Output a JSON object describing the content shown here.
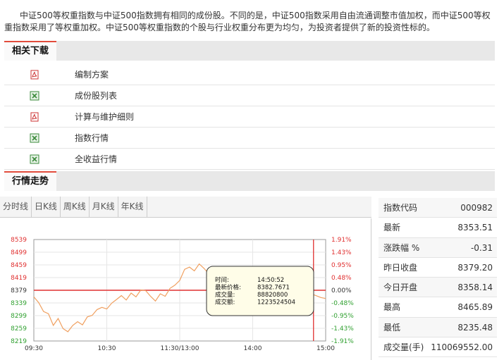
{
  "intro": "中证500等权重指数与中证500指数拥有相同的成份股。不同的是，中证500指数采用自由流通调整市值加权，而中证500等权重指数采用了等权重加权。中证500等权重指数的个股与行业权重分布更为均匀，为投资者提供了新的投资性标的。",
  "downloads": {
    "title": "相关下载",
    "items": [
      {
        "label": "编制方案",
        "icon": "pdf-icon"
      },
      {
        "label": "成份股列表",
        "icon": "excel-icon"
      },
      {
        "label": "计算与维护细则",
        "icon": "pdf-icon"
      },
      {
        "label": "指数行情",
        "icon": "excel-icon"
      },
      {
        "label": "全收益行情",
        "icon": "excel-icon"
      }
    ]
  },
  "market": {
    "title": "行情走势",
    "tabs": [
      "分时线",
      "日K线",
      "周K线",
      "月K线",
      "年K线"
    ]
  },
  "quote": [
    {
      "label": "指数代码",
      "value": "000982"
    },
    {
      "label": "最新",
      "value": "8353.51"
    },
    {
      "label": "涨跌幅 %",
      "value": "-0.31"
    },
    {
      "label": "昨日收盘",
      "value": "8379.20"
    },
    {
      "label": "今日开盘",
      "value": "8358.14"
    },
    {
      "label": "最高",
      "value": "8465.89"
    },
    {
      "label": "最低",
      "value": "8235.48"
    },
    {
      "label": "成交量(手)",
      "value": "110069552.00"
    }
  ],
  "colors": {
    "accent": "#e24c3c",
    "line": "#f0a060",
    "up": "#e03030",
    "down": "#30a030"
  },
  "chart_data": {
    "type": "line",
    "y_ticks": [
      "8539",
      "8499",
      "8459",
      "8419",
      "8379",
      "8339",
      "8299",
      "8259",
      "8219"
    ],
    "y_right_ticks": [
      "1.91%",
      "1.43%",
      "0.95%",
      "0.48%",
      "0.00%",
      "-0.48%",
      "-0.95%",
      "-1.43%",
      "-1.91%"
    ],
    "x_ticks": [
      "09:30",
      "10:30",
      "11:30/13:00",
      "14:00",
      "15:00"
    ],
    "ylim": [
      8219,
      8539
    ],
    "base": 8379,
    "x_minutes": [
      0,
      4,
      8,
      12,
      16,
      20,
      24,
      28,
      32,
      36,
      40,
      44,
      48,
      52,
      56,
      60,
      64,
      68,
      72,
      76,
      80,
      84,
      88,
      92,
      96,
      100,
      104,
      108,
      112,
      116,
      120,
      124,
      128,
      132,
      136,
      140,
      144,
      148,
      152,
      156,
      160,
      164,
      168,
      172,
      176,
      180,
      184,
      188,
      192,
      196,
      200,
      204,
      208,
      212,
      216,
      220,
      224,
      228,
      232,
      236,
      240
    ],
    "values": [
      8358,
      8340,
      8312,
      8305,
      8268,
      8290,
      8258,
      8248,
      8268,
      8280,
      8270,
      8295,
      8300,
      8318,
      8325,
      8320,
      8338,
      8350,
      8362,
      8348,
      8370,
      8358,
      8380,
      8378,
      8360,
      8345,
      8368,
      8360,
      8385,
      8395,
      8410,
      8445,
      8452,
      8440,
      8462,
      8448,
      8430,
      8418,
      8428,
      8432,
      8416,
      8422,
      8405,
      8412,
      8398,
      8405,
      8402,
      8390,
      8380,
      8392,
      8385,
      8395,
      8378,
      8388,
      8372,
      8365,
      8375,
      8368,
      8362,
      8356,
      8353
    ],
    "cursor_minute": 230,
    "tooltip": {
      "time_label": "时间:",
      "time": "14:50:52",
      "price_label": "最新价格:",
      "price": "8382.7671",
      "volume_label": "成交量:",
      "volume": "88820800",
      "amount_label": "成交额:",
      "amount": "1223524504"
    }
  }
}
